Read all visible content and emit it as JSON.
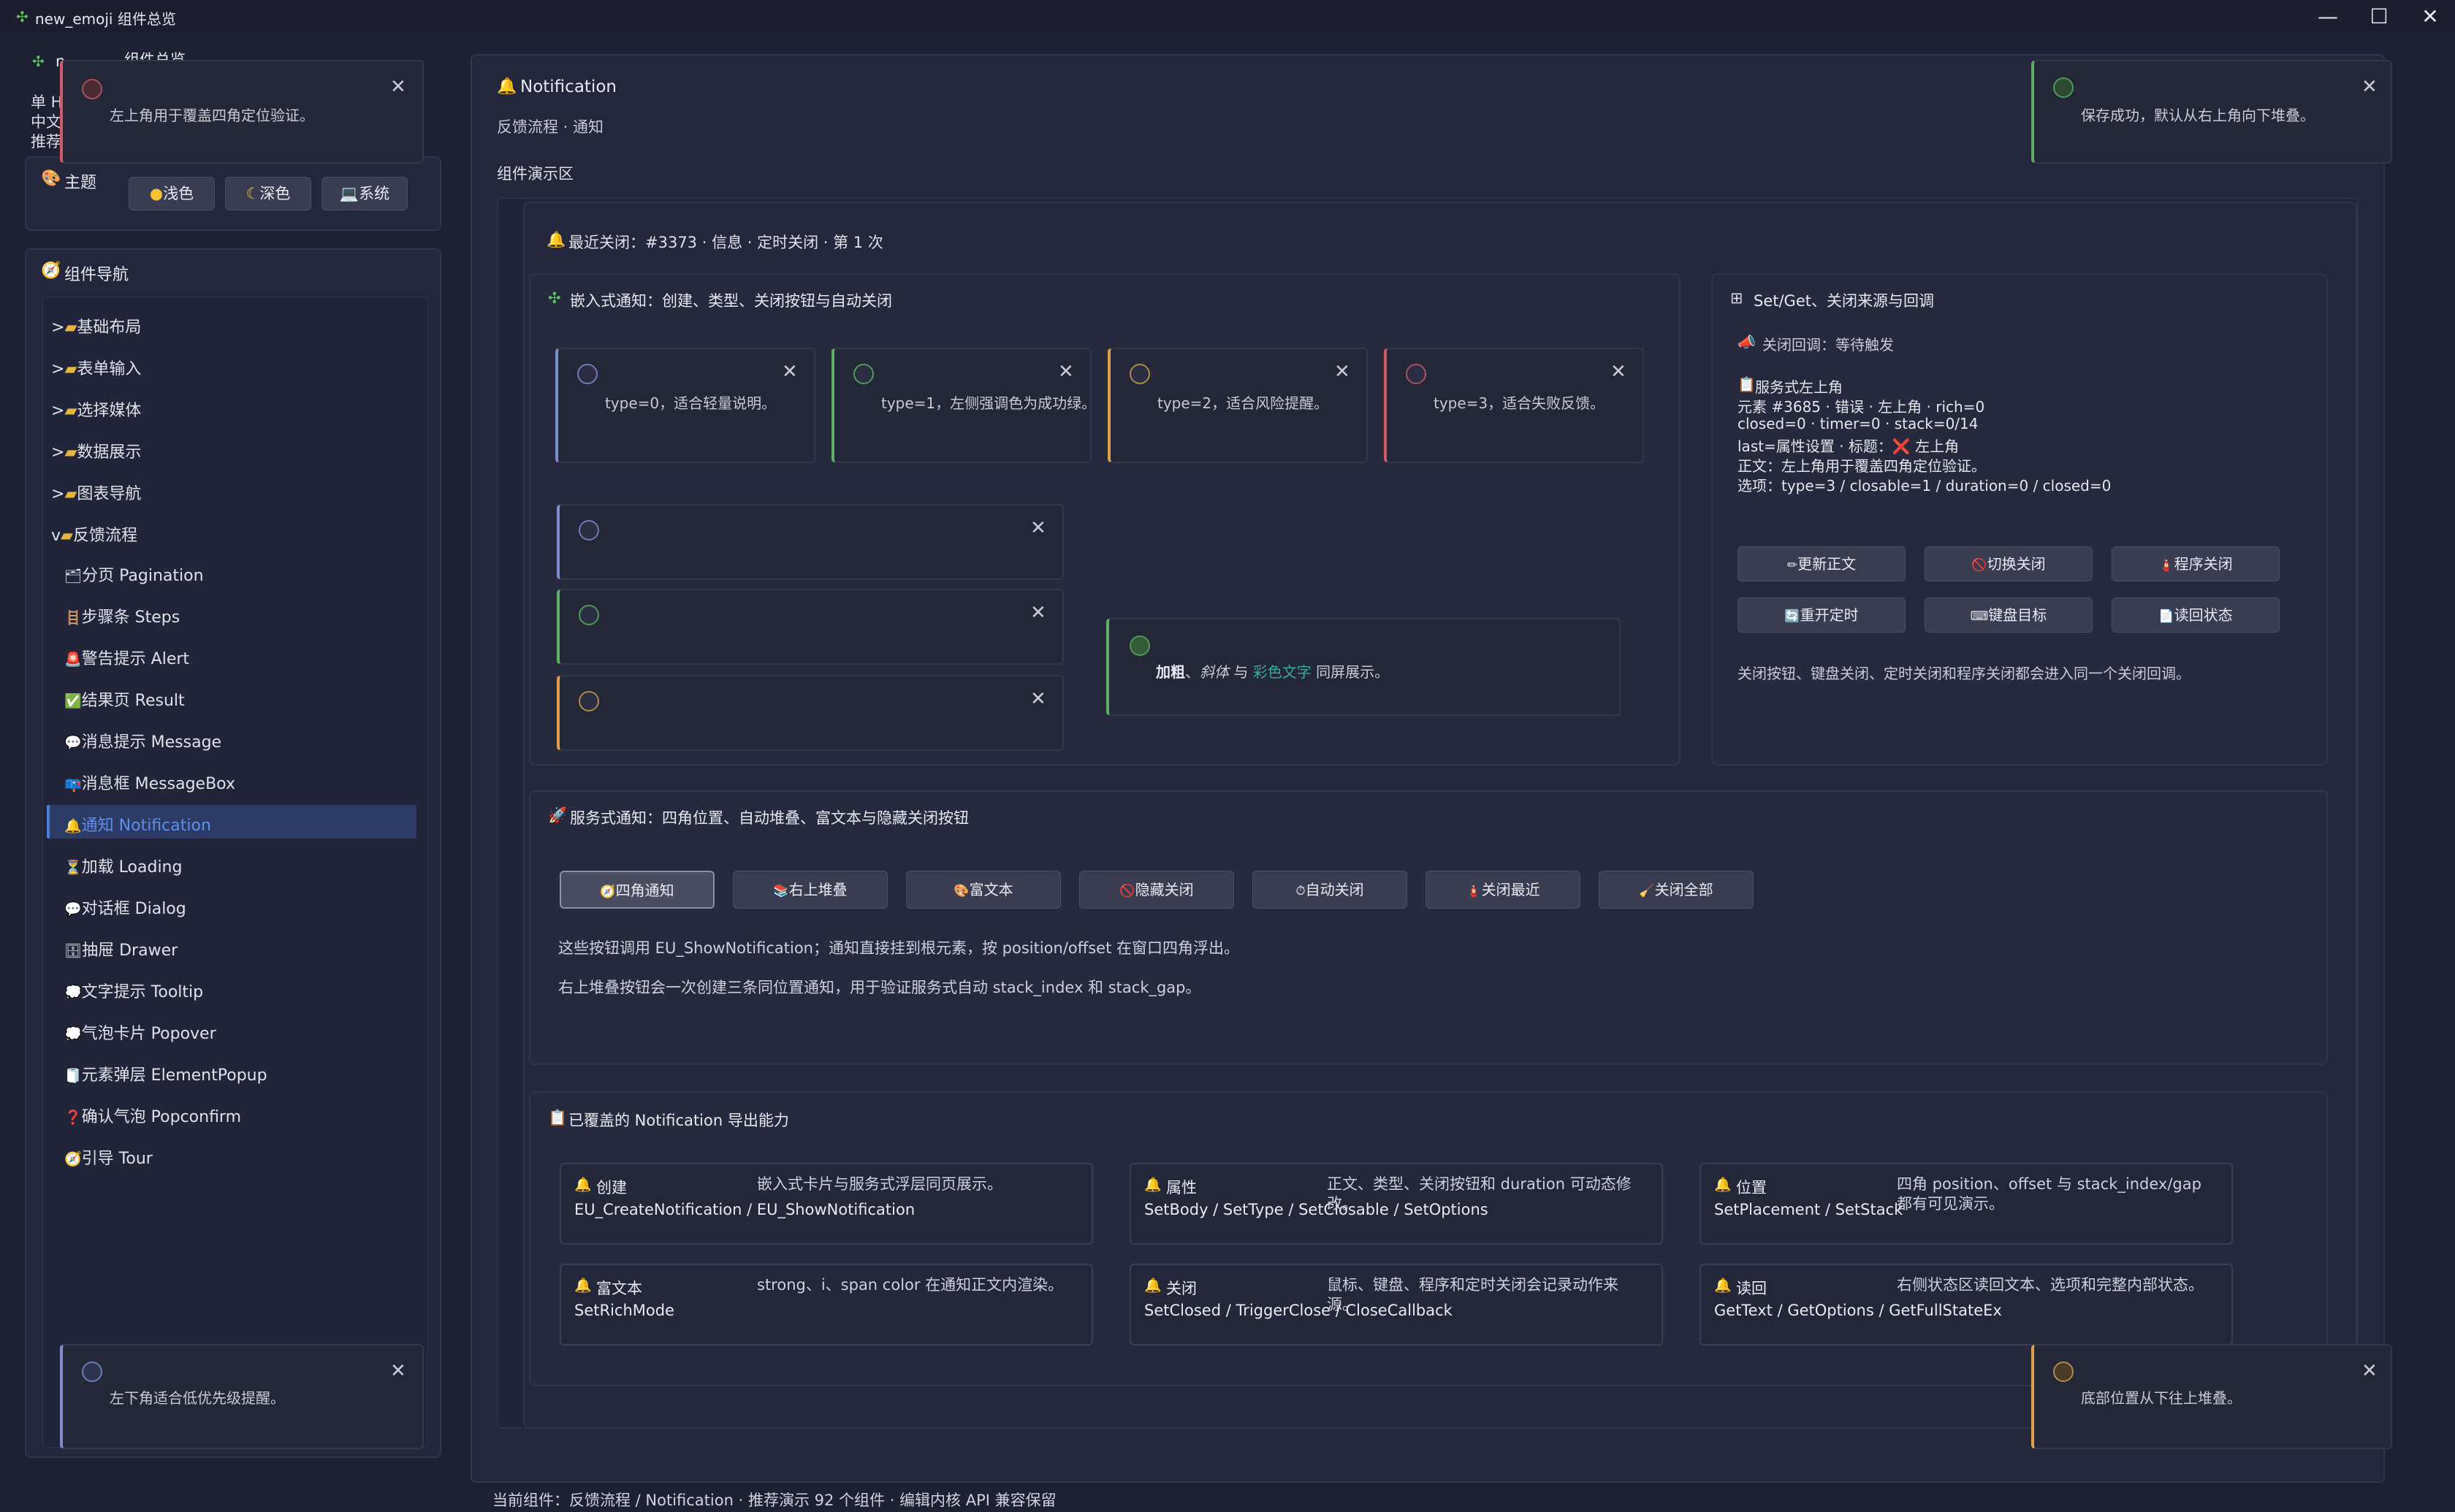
{
  "window": {
    "title": "new_emoji 组件总览",
    "app_icon": "puzzle-icon",
    "controls": [
      "minimize-icon",
      "maximize-icon",
      "close-icon"
    ]
  },
  "header_left": {
    "title_partial": "n",
    "title_partial2": "组件总览",
    "line1": "单 H",
    "line2": "中文",
    "line3": "推荐"
  },
  "theme": {
    "label": "主题",
    "light": "浅色",
    "dark": "深色",
    "system": "系统"
  },
  "nav": {
    "title": "组件导航",
    "groups": [
      {
        "prefix": ">",
        "label": "基础布局"
      },
      {
        "prefix": ">",
        "label": "表单输入"
      },
      {
        "prefix": ">",
        "label": "选择媒体"
      },
      {
        "prefix": ">",
        "label": "数据展示"
      },
      {
        "prefix": ">",
        "label": "图表导航"
      },
      {
        "prefix": "v",
        "label": "反馈流程"
      }
    ],
    "items": [
      {
        "label": "分页 Pagination",
        "icon": "🗂"
      },
      {
        "label": "步骤条 Steps",
        "icon": "🪜"
      },
      {
        "label": "警告提示 Alert",
        "icon": "🚨"
      },
      {
        "label": "结果页 Result",
        "icon": "✅"
      },
      {
        "label": "消息提示 Message",
        "icon": "💬"
      },
      {
        "label": "消息框 MessageBox",
        "icon": "📪"
      },
      {
        "label": "通知 Notification",
        "icon": "🔔",
        "active": true
      },
      {
        "label": "加载 Loading",
        "icon": "⏳"
      },
      {
        "label": "对话框 Dialog",
        "icon": "💬"
      },
      {
        "label": "抽屉 Drawer",
        "icon": "🗄"
      },
      {
        "label": "文字提示 Tooltip",
        "icon": "💭"
      },
      {
        "label": "气泡卡片 Popover",
        "icon": "💭"
      },
      {
        "label": "元素弹层 ElementPopup",
        "icon": "🧻"
      },
      {
        "label": "确认气泡 Popconfirm",
        "icon": "❓"
      },
      {
        "label": "引导 Tour",
        "icon": "🧭"
      }
    ]
  },
  "page": {
    "title": "Notification",
    "subtitle": "反馈流程 · 通知",
    "demo_label": "组件演示区",
    "last_closed": "最近关闭：#3373 · 信息 · 定时关闭 · 第 1 次"
  },
  "embedded": {
    "title": "嵌入式通知：创建、类型、关闭按钮与自动关闭",
    "cards": [
      {
        "text": "type=0，适合轻量说明。",
        "color": "#6b7db5",
        "bar": "#7c8ed0"
      },
      {
        "text": "type=1，左侧强调色为成功绿。",
        "color": "#4e9a55",
        "bar": "#5fb065"
      },
      {
        "text": "type=2，适合风险提醒。",
        "color": "#b0894a",
        "bar": "#e0a04a"
      },
      {
        "text": "type=3，适合失败反馈。",
        "color": "#a8505f",
        "bar": "#d05a6a"
      }
    ],
    "rich": {
      "bold": "加粗",
      "sep1": "、",
      "italic": "斜体",
      "sep2": " 与 ",
      "colored": "彩色文字",
      "tail": " 同屏展示。"
    }
  },
  "setget": {
    "title": "Set/Get、关闭来源与回调",
    "callback": "关闭回调：等待触发",
    "info_lines": [
      "服务式左上角",
      "元素 #3685 · 错误 · 左上角 · rich=0",
      "closed=0 · timer=0 · stack=0/14",
      "last=属性设置 · 标题：❌ 左上角",
      "正文：左上角用于覆盖四角定位验证。",
      "选项：type=3 / closable=1 / duration=0 / closed=0"
    ],
    "buttons": [
      {
        "icon": "✏",
        "label": "更新正文"
      },
      {
        "icon": "🚫",
        "label": "切换关闭"
      },
      {
        "icon": "🧯",
        "label": "程序关闭"
      },
      {
        "icon": "🔄",
        "label": "重开定时"
      },
      {
        "icon": "⌨",
        "label": "键盘目标"
      },
      {
        "icon": "📄",
        "label": "读回状态"
      }
    ],
    "note": "关闭按钮、键盘关闭、定时关闭和程序关闭都会进入同一个关闭回调。"
  },
  "service": {
    "title": "服务式通知：四角位置、自动堆叠、富文本与隐藏关闭按钮",
    "buttons": [
      {
        "icon": "🧭",
        "label": "四角通知",
        "active": true
      },
      {
        "icon": "📚",
        "label": "右上堆叠"
      },
      {
        "icon": "🎨",
        "label": "富文本"
      },
      {
        "icon": "🚫",
        "label": "隐藏关闭"
      },
      {
        "icon": "⏱",
        "label": "自动关闭"
      },
      {
        "icon": "🧯",
        "label": "关闭最近"
      },
      {
        "icon": "🧹",
        "label": "关闭全部"
      }
    ],
    "desc1": "这些按钮调用 EU_ShowNotification；通知直接挂到根元素，按 position/offset 在窗口四角浮出。",
    "desc2": "右上堆叠按钮会一次创建三条同位置通知，用于验证服务式自动 stack_index 和 stack_gap。"
  },
  "capabilities": {
    "title": "已覆盖的 Notification 导出能力",
    "items": [
      {
        "name": "创建",
        "api": "EU_CreateNotification / EU_ShowNotification",
        "desc": "嵌入式卡片与服务式浮层同页展示。"
      },
      {
        "name": "属性",
        "api": "SetBody / SetType / SetClosable / SetOptions",
        "desc": "正文、类型、关闭按钮和 duration 可动态修改。"
      },
      {
        "name": "位置",
        "api": "SetPlacement / SetStack",
        "desc": "四角 position、offset 与 stack_index/gap 都有可见演示。"
      },
      {
        "name": "富文本",
        "api": "SetRichMode",
        "desc": "strong、i、span color 在通知正文内渲染。"
      },
      {
        "name": "关闭",
        "api": "SetClosed / TriggerClose / CloseCallback",
        "desc": "鼠标、键盘、程序和定时关闭会记录动作来源。"
      },
      {
        "name": "读回",
        "api": "GetText / GetOptions / GetFullStateEx",
        "desc": "右侧状态区读回文本、选项和完整内部状态。"
      }
    ]
  },
  "floating": {
    "top_left": "左上角用于覆盖四角定位验证。",
    "top_right": "保存成功，默认从右上角向下堆叠。",
    "bottom_left": "左下角适合低优先级提醒。",
    "bottom_right": "底部位置从下往上堆叠。"
  },
  "status_bar": "当前组件：反馈流程 / Notification · 推荐演示 92 个组件 · 编辑内核 API 兼容保留",
  "colors": {
    "background": "#1e2033",
    "accent": "#4a7bd6",
    "info": "#6b7db5",
    "success": "#4e9a55",
    "warning": "#e0a04a",
    "error": "#d05a6a",
    "teal": "#3aaaa0"
  }
}
